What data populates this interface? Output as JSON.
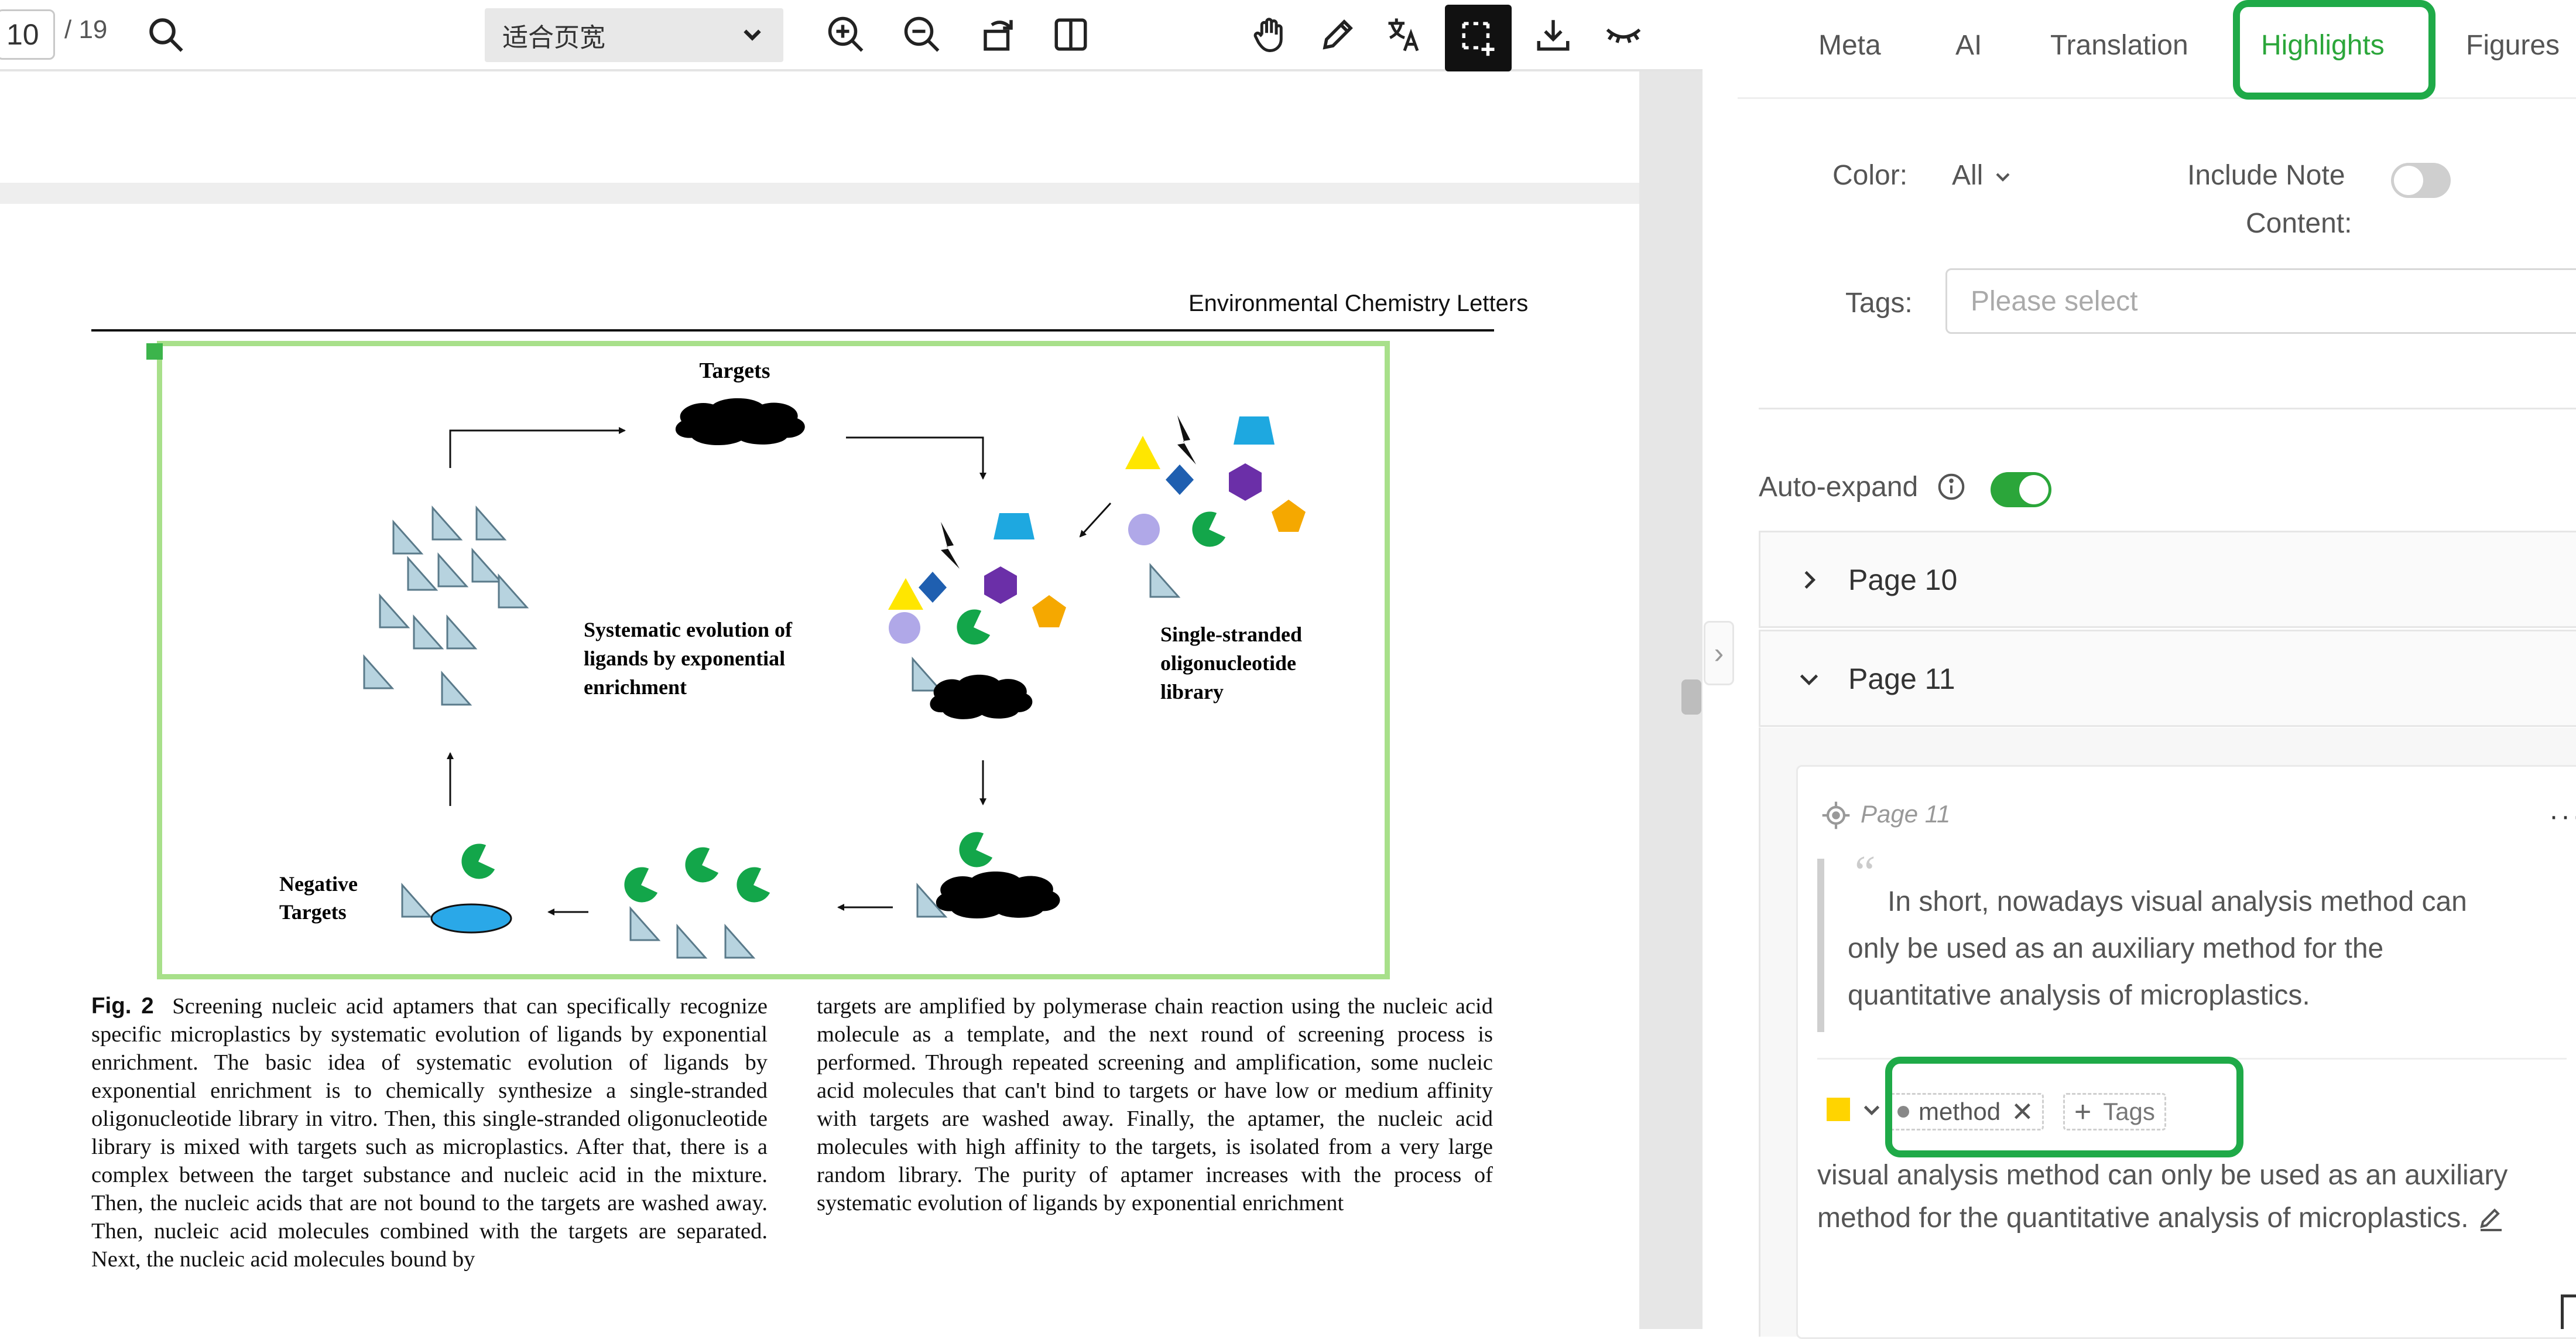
{
  "toolbar": {
    "page_number": "10",
    "page_total": "/ 19",
    "zoom_label": "适合页宽",
    "icons": [
      "search-icon",
      "zoom-in-icon",
      "zoom-out-icon",
      "rotate-icon",
      "two-page-icon",
      "hand-icon",
      "pencil-icon",
      "translate-icon",
      "area-select-icon",
      "download-icon",
      "eye-closed-icon"
    ]
  },
  "document": {
    "journal_name": "Environmental Chemistry Letters",
    "figure": {
      "targets_label": "Targets",
      "selex_label_1": "Systematic evolution of",
      "selex_label_2": "ligands by exponential",
      "selex_label_3": "enrichment",
      "library_label_1": "Single-stranded",
      "library_label_2": "oligonucleotide",
      "library_label_3": "library",
      "negative_label_1": "Negative",
      "negative_label_2": "Targets"
    },
    "caption_label": "Fig. 2",
    "caption_left": "Screening nucleic acid aptamers that can specifically recognize specific microplastics by systematic evolution of ligands by exponential enrichment. The basic idea of systematic evolution of ligands by exponential enrichment is to chemically synthesize a single-stranded oligonucleotide library in vitro. Then, this single-stranded oligonucleotide library is mixed with targets such as microplastics. After that, there is a complex between the target substance and nucleic acid in the mixture. Then, the nucleic acids that are not bound to the targets are washed away. Then, nucleic acid molecules combined with the targets are separated. Next, the nucleic acid molecules bound by",
    "caption_right": "targets are amplified by polymerase chain reaction using the nucleic acid molecule as a template, and the next round of screening process is performed. Through repeated screening and amplification, some nucleic acid molecules that can't bind to targets or have low or medium affinity with targets are washed away. Finally, the aptamer, the nucleic acid molecules with high affinity to the targets, is isolated from a very large random library. The purity of aptamer increases with the process of systematic evolution of ligands by exponential enrichment"
  },
  "sidebar": {
    "tabs": [
      "Meta",
      "AI",
      "Translation",
      "Highlights",
      "Figures"
    ],
    "active_tab": "Highlights",
    "collapse_glyph": "›",
    "filters": {
      "color_label": "Color:",
      "color_value": "All",
      "include_note_label_1": "Include Note",
      "include_note_label_2": "Content:",
      "tags_label": "Tags:",
      "tags_placeholder": "Please select"
    },
    "auto_expand_label": "Auto-expand",
    "accordion": [
      {
        "label": "Page 10",
        "expanded": false
      },
      {
        "label": "Page 11",
        "expanded": true
      }
    ],
    "highlight_card": {
      "page": "Page 11",
      "more": "···",
      "quote_mark": "“",
      "quote": "In short, nowadays visual analysis method can only be used as an auxiliary method for the quantitative analysis of microplastics.",
      "color": "#ffd400",
      "tag": "method",
      "tag_remove": "✕",
      "add_tag_plus": "+",
      "add_tag_label": "Tags",
      "note": "visual analysis method can only be used as an auxiliary method for the quantitative analysis of microplastics."
    }
  },
  "colors": {
    "accent": "#2ba63a",
    "annotation_box": "#1faa48",
    "figure_border": "#a8e08a"
  }
}
